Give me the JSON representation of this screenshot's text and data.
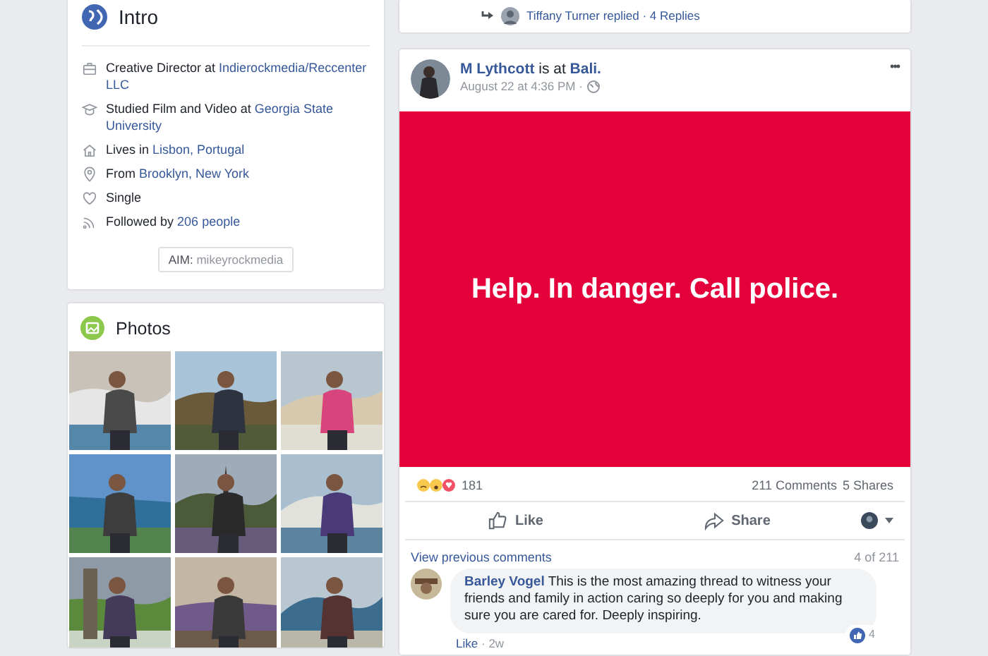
{
  "intro": {
    "title": "Intro",
    "items": [
      {
        "kind": "work",
        "text": "Creative Director at",
        "link": "Indierockmedia/Reccenter LLC"
      },
      {
        "kind": "education",
        "text": "Studied Film and Video at",
        "link": "Georgia State University"
      },
      {
        "kind": "home",
        "text": "Lives in",
        "link": "Lisbon, Portugal"
      },
      {
        "kind": "location",
        "text": "From",
        "link": "Brooklyn, New York"
      },
      {
        "kind": "relationship",
        "text": "Single"
      },
      {
        "kind": "followers",
        "text": "Followed by",
        "link": "206 people"
      }
    ],
    "aim": {
      "label": "AIM:",
      "handle": "mikeyrockmedia"
    }
  },
  "photos": {
    "title": "Photos"
  },
  "reply_line": {
    "name": "Tiffany Turner",
    "text": "replied",
    "separator": "·",
    "count": "4 Replies"
  },
  "post": {
    "author": "M Lythcott",
    "place_text": "is at",
    "place": "Bali.",
    "time": "August 22 at 4:36 PM",
    "time_separator": "·",
    "more": "•••",
    "message": "Help. In danger. Call police.",
    "reaction_count": "181",
    "comments": "211 Comments",
    "shares": "5 Shares",
    "actions": [
      {
        "kind": "like",
        "label": "Like"
      },
      {
        "kind": "share",
        "label": "Share"
      }
    ],
    "view_previous": "View previous comments",
    "comment_position": "4 of 211",
    "comment": {
      "author": "Barley Vogel",
      "text": "This is the most amazing thread to witness your friends and family in action caring so deeply for you and making sure you are cared for. Deeply inspiring.",
      "likes": "4",
      "like_link": "Like",
      "separator": "·",
      "age": "2w"
    }
  }
}
